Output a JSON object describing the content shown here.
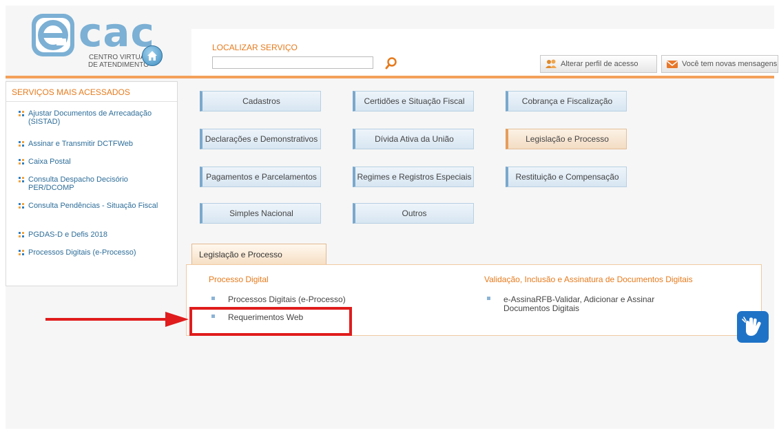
{
  "header": {
    "logo_word": "cac",
    "logo_subtitle_line1": "CENTRO VIRTUAL",
    "logo_subtitle_line2": "DE ATENDIMENTO",
    "search_label": "LOCALIZAR SERVIÇO",
    "search_value": "",
    "profile_button": "Alterar perfil de acesso",
    "messages_button": "Você tem novas mensagens"
  },
  "sidebar": {
    "title": "SERVIÇOS MAIS ACESSADOS",
    "items": [
      {
        "label": "Ajustar Documentos de Arrecadação (SISTAD)"
      },
      {
        "label": "Assinar e Transmitir DCTFWeb"
      },
      {
        "label": "Caixa Postal"
      },
      {
        "label": "Consulta Despacho Decisório PER/DCOMP"
      },
      {
        "label": "Consulta Pendências - Situação Fiscal"
      },
      {
        "label": "PGDAS-D e Defis 2018"
      },
      {
        "label": "Processos Digitais (e-Processo)"
      }
    ]
  },
  "categories": [
    {
      "label": "Cadastros"
    },
    {
      "label": "Certidões e Situação Fiscal"
    },
    {
      "label": "Cobrança e Fiscalização"
    },
    {
      "label": "Declarações e Demonstrativos"
    },
    {
      "label": "Dívida Ativa da União"
    },
    {
      "label": "Legislação e Processo"
    },
    {
      "label": "Pagamentos e Parcelamentos"
    },
    {
      "label": "Regimes e Registros Especiais"
    },
    {
      "label": "Restituição e Compensação"
    },
    {
      "label": "Simples Nacional"
    },
    {
      "label": "Outros"
    }
  ],
  "panel": {
    "tab_label": "Legislação e Processo",
    "col1_title": "Processo Digital",
    "col1_links": [
      {
        "label": "Processos Digitais (e-Processo)"
      },
      {
        "label": "Requerimentos Web"
      }
    ],
    "col2_title": "Validação, Inclusão e Assinatura de Documentos Digitais",
    "col2_links": [
      {
        "label": "e-AssinaRFB-Validar, Adicionar e Assinar Documentos Digitais"
      }
    ]
  },
  "colors": {
    "accent_orange": "#e67a1c",
    "link_blue": "#2d6d99",
    "highlight_red": "#e01c1c",
    "accessibility_blue": "#1f73c7"
  }
}
